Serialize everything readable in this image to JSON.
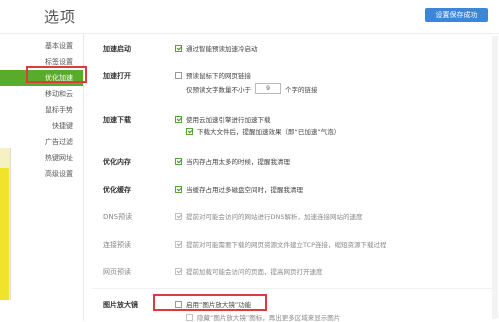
{
  "title": "选项",
  "save_button": "设置保存成功",
  "sidebar": {
    "items": [
      {
        "label": "基本设置"
      },
      {
        "label": "标签设置"
      },
      {
        "label": "优化加速"
      },
      {
        "label": "移动和云"
      },
      {
        "label": "鼠标手势"
      },
      {
        "label": "快捷键"
      },
      {
        "label": "广告过滤"
      },
      {
        "label": "热键网址"
      },
      {
        "label": "高级设置"
      }
    ]
  },
  "sections": {
    "startup": {
      "label": "加速启动",
      "opt1": "通过智能预读加速冷启动"
    },
    "open": {
      "label": "加速打开",
      "opt1": "预读鼠标下的网页链接",
      "sub_prefix": "仅预读文字数量不小于",
      "sub_value": "9",
      "sub_suffix": "个字的链接"
    },
    "download": {
      "label": "加速下载",
      "opt1": "使用云加速引擎进行加速下载",
      "opt2": "下载大文件后，提醒加速效果（即“已加速”气泡）"
    },
    "memory": {
      "label": "优化内存",
      "opt1": "当内存占用太多的时候，提醒我清理"
    },
    "cache": {
      "label": "优化缓存",
      "opt1": "当缓存占用过多磁盘空间时，提醒我清理"
    },
    "dns": {
      "label": "DNS预读",
      "opt1": "提前对可能会访问的网站进行DNS解析，加速连接网站的速度"
    },
    "connect": {
      "label": "连接预读",
      "opt1": "提前对可能需要下载的网页资源文件建立TCP连接，缩短资源下载过程"
    },
    "page": {
      "label": "网页预读",
      "opt1": "提前加载可能会访问的页面，提高网页打开速度"
    },
    "magnifier": {
      "label": "图片放大镜",
      "opt1": "启用“图片放大镜”功能",
      "opt2": "隐藏“图片放大镜”图标，再出更多区域来显示图片"
    }
  },
  "colors": {
    "accent_green": "#5aab2a",
    "button_blue": "#3d86d6",
    "highlight_red": "#e23a3a"
  }
}
